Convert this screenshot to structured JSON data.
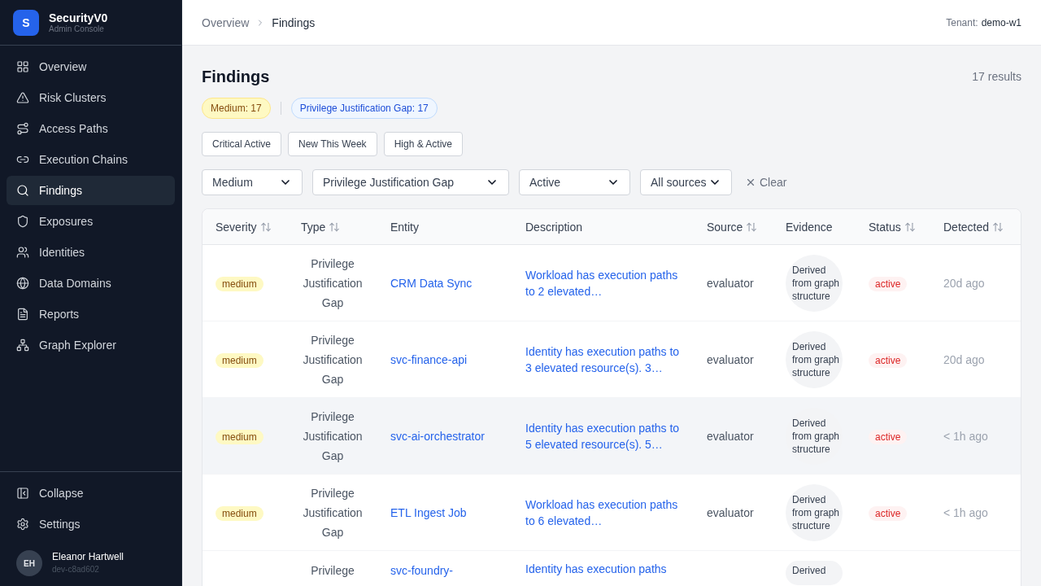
{
  "brand": {
    "logo": "S",
    "name": "SecurityV0",
    "subtitle": "Admin Console"
  },
  "nav": [
    {
      "label": "Overview",
      "selected": false
    },
    {
      "label": "Risk Clusters",
      "selected": false
    },
    {
      "label": "Access Paths",
      "selected": false
    },
    {
      "label": "Execution Chains",
      "selected": false
    },
    {
      "label": "Findings",
      "selected": true
    },
    {
      "label": "Exposures",
      "selected": false
    },
    {
      "label": "Identities",
      "selected": false
    },
    {
      "label": "Data Domains",
      "selected": false
    },
    {
      "label": "Reports",
      "selected": false
    },
    {
      "label": "Graph Explorer",
      "selected": false
    }
  ],
  "footer_nav": [
    "Collapse",
    "Settings"
  ],
  "user": {
    "initials": "EH",
    "name": "Eleanor Hartwell",
    "id": "dev-c8ad602"
  },
  "breadcrumb": [
    "Overview",
    "Findings"
  ],
  "tenant": {
    "label": "Tenant:",
    "value": "demo-w1"
  },
  "title": "Findings",
  "results": "17 results",
  "active_filters": [
    {
      "label": "Medium: 17",
      "color": "#fef9c3"
    },
    {
      "label": "Privilege Justification Gap: 17",
      "color": "#eff6ff"
    }
  ],
  "presets": [
    "Critical Active",
    "New This Week",
    "High & Active"
  ],
  "selects": [
    "Medium",
    "Privilege Justification Gap",
    "Active",
    "All sources"
  ],
  "clear": "Clear",
  "columns": [
    {
      "label": "Severity",
      "sortable": true
    },
    {
      "label": "Type",
      "sortable": true
    },
    {
      "label": "Entity",
      "sortable": false
    },
    {
      "label": "Description",
      "sortable": false
    },
    {
      "label": "Source",
      "sortable": true
    },
    {
      "label": "Evidence",
      "sortable": false
    },
    {
      "label": "Status",
      "sortable": true
    },
    {
      "label": "Detected",
      "sortable": true
    }
  ],
  "rows": [
    {
      "severity": "medium",
      "type": "Privilege Justification Gap",
      "entity": "CRM Data Sync",
      "description": "Workload has execution paths to 2 elevated…",
      "source": "evaluator",
      "evidence": "Derived from graph structure",
      "status": "active",
      "detected": "20d ago",
      "selected": false
    },
    {
      "severity": "medium",
      "type": "Privilege Justification Gap",
      "entity": "svc-finance-api",
      "description": "Identity has execution paths to 3 elevated resource(s). 3…",
      "source": "evaluator",
      "evidence": "Derived from graph structure",
      "status": "active",
      "detected": "20d ago",
      "selected": false
    },
    {
      "severity": "medium",
      "type": "Privilege Justification Gap",
      "entity": "svc-ai-orchestrator",
      "description": "Identity has execution paths to 5 elevated resource(s). 5…",
      "source": "evaluator",
      "evidence": "Derived from graph structure",
      "status": "active",
      "detected": "< 1h ago",
      "selected": true
    },
    {
      "severity": "medium",
      "type": "Privilege Justification Gap",
      "entity": "ETL Ingest Job",
      "description": "Workload has execution paths to 6 elevated…",
      "source": "evaluator",
      "evidence": "Derived from graph structure",
      "status": "active",
      "detected": "< 1h ago",
      "selected": false
    },
    {
      "type": "Privilege",
      "entity": "svc-foundry-",
      "description": "Identity has execution paths",
      "evidence": "Derived",
      "selected": false
    }
  ]
}
